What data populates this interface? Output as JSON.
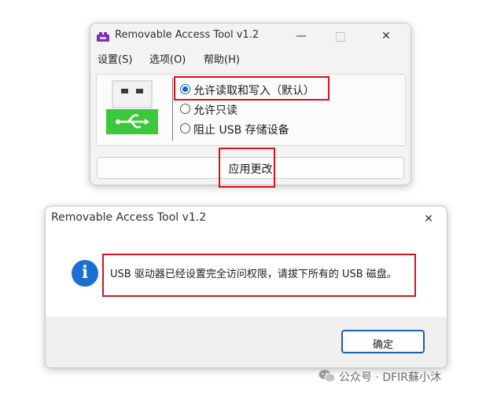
{
  "main_window": {
    "title": "Removable Access Tool v1.2",
    "minimize_symbol": "—",
    "close_symbol": "✕",
    "menu": [
      "设置(S)",
      "选项(O)",
      "帮助(H)"
    ],
    "options": [
      {
        "label": "允许读取和写入（默认）",
        "checked": true
      },
      {
        "label": "允许只读",
        "checked": false
      },
      {
        "label": "阻止 USB 存储设备",
        "checked": false
      }
    ],
    "apply_label": "应用更改"
  },
  "dialog": {
    "title": "Removable Access Tool v1.2",
    "close_symbol": "✕",
    "info_glyph": "i",
    "message": "USB 驱动器已经设置完全访问权限，请拔下所有的 USB 磁盘。",
    "ok_label": "确定"
  },
  "watermark": {
    "text": "公众号 · DFIR蘇小沐"
  },
  "colors": {
    "highlight": "#d2141e",
    "accent": "#0a64c8",
    "usb_green": "#3cc83c"
  },
  "icons": [
    "app-icon",
    "usb-drive-icon",
    "info-icon",
    "wechat-icon"
  ]
}
